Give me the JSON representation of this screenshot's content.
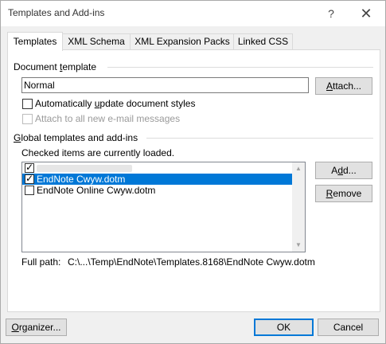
{
  "window": {
    "title": "Templates and Add-ins",
    "help_glyph": "?",
    "close_glyph": "✕"
  },
  "tabs": [
    {
      "label": "Templates",
      "active": true
    },
    {
      "label": "XML Schema",
      "active": false
    },
    {
      "label": "XML Expansion Packs",
      "active": false
    },
    {
      "label": "Linked CSS",
      "active": false
    }
  ],
  "document_template": {
    "group_label_pre": "Document ",
    "group_label_ul": "t",
    "group_label_post": "emplate",
    "template_value": "Normal",
    "attach_label_pre": "",
    "attach_label_ul": "A",
    "attach_label_post": "ttach...",
    "auto_update_label_pre": "Automatically ",
    "auto_update_label_ul": "u",
    "auto_update_label_post": "pdate document styles",
    "auto_update_checked": false,
    "attach_all_label": "Attach to all new e-mail messages",
    "attach_all_checked": false,
    "attach_all_enabled": false
  },
  "global_templates": {
    "group_label_pre": "",
    "group_label_ul": "G",
    "group_label_post": "lobal templates and add-ins",
    "note": "Checked items are currently loaded.",
    "items": [
      {
        "label": "",
        "checked": true,
        "selected": false
      },
      {
        "label": "EndNote Cwyw.dotm",
        "checked": true,
        "selected": true
      },
      {
        "label": "EndNote Online Cwyw.dotm",
        "checked": false,
        "selected": false
      }
    ],
    "add_label_pre": "A",
    "add_label_ul": "d",
    "add_label_post": "d...",
    "remove_label_pre": "",
    "remove_label_ul": "R",
    "remove_label_post": "emove",
    "full_path_label": "Full path:",
    "full_path_value": "C:\\...\\Temp\\EndNote\\Templates.8168\\EndNote Cwyw.dotm"
  },
  "footer": {
    "organizer_label_pre": "",
    "organizer_label_ul": "O",
    "organizer_label_post": "rganizer...",
    "ok_label": "OK",
    "cancel_label": "Cancel"
  },
  "colors": {
    "accent": "#0078d7",
    "dialog_bg": "#f0f0f0"
  },
  "icons": {
    "help": "question-mark",
    "close": "close-x",
    "scroll_up": "chevron-up",
    "scroll_down": "chevron-down",
    "checkbox_checked": "check-mark"
  }
}
